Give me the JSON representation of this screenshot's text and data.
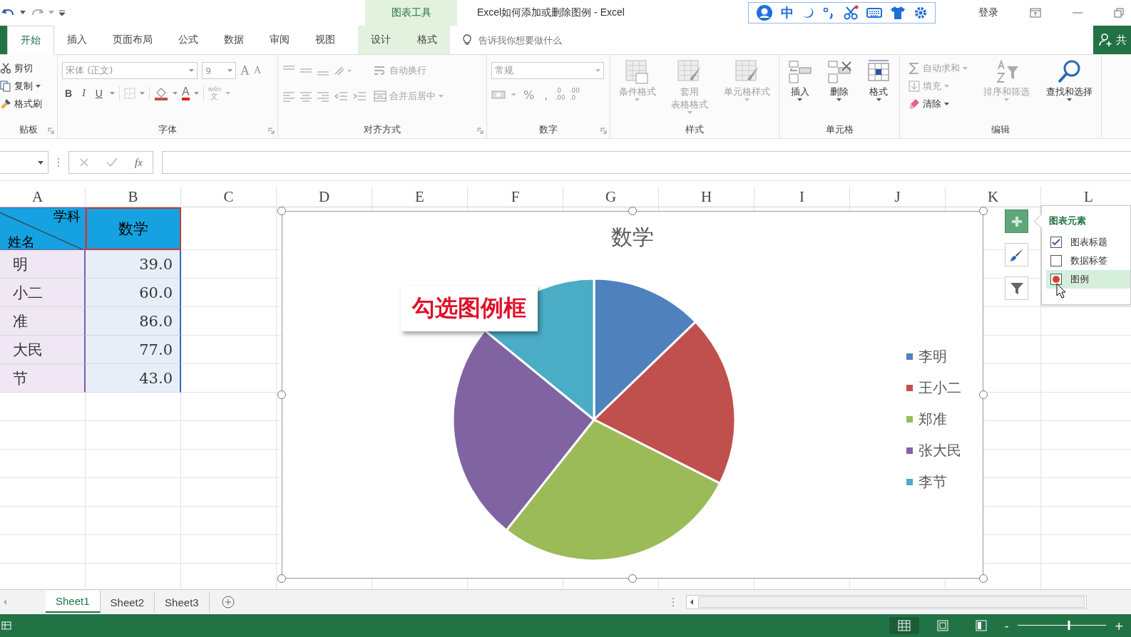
{
  "contextual_tab": "图表工具",
  "window": {
    "title": "Excel如何添加或删除图例  -  Excel",
    "ime_mode": "中",
    "sign_in": "登录"
  },
  "tabs": [
    {
      "label": "开始",
      "selected": true,
      "context": false
    },
    {
      "label": "插入",
      "selected": false,
      "context": false
    },
    {
      "label": "页面布局",
      "selected": false,
      "context": false
    },
    {
      "label": "公式",
      "selected": false,
      "context": false
    },
    {
      "label": "数据",
      "selected": false,
      "context": false
    },
    {
      "label": "审阅",
      "selected": false,
      "context": false
    },
    {
      "label": "视图",
      "selected": false,
      "context": false
    },
    {
      "label": "设计",
      "selected": false,
      "context": true
    },
    {
      "label": "格式",
      "selected": false,
      "context": true
    }
  ],
  "tell_me": {
    "placeholder": "告诉我你想要做什么"
  },
  "share": {
    "label": "共"
  },
  "ribbon": {
    "groups": [
      {
        "kind": "clipboard",
        "label": "贴板",
        "commands": [
          {
            "label": "剪切",
            "disabled": false
          },
          {
            "label": "复制",
            "disabled": false
          },
          {
            "label": "格式刷",
            "disabled": false
          }
        ]
      },
      {
        "kind": "font",
        "label": "字体",
        "disabled": true,
        "font_name": "宋体 (正文)",
        "font_size": "9",
        "grow_shrink": [
          "A",
          "A"
        ],
        "styles": [
          "B",
          "I",
          "U"
        ],
        "font_color": "A",
        "phonetic": [
          "wén",
          "文"
        ]
      },
      {
        "kind": "alignment",
        "label": "对齐方式",
        "disabled": true,
        "commands": [
          {
            "label": "自动换行"
          },
          {
            "label": "合并后居中"
          }
        ]
      },
      {
        "kind": "number",
        "label": "数字",
        "disabled": true,
        "format": "常规",
        "symbols": [
          "%",
          ","
        ],
        "decimals": [
          {
            "top": ".0",
            "bottom": ".00"
          },
          {
            "top": ".00",
            "bottom": ".0"
          }
        ]
      },
      {
        "kind": "styles",
        "label": "样式",
        "commands": [
          {
            "label": "条件格式",
            "disabled": true
          },
          {
            "label": "套用",
            "label_2": "表格格式",
            "disabled": true
          },
          {
            "label": "单元格样式",
            "disabled": true
          }
        ]
      },
      {
        "kind": "cells",
        "label": "单元格",
        "commands": [
          {
            "label": "插入",
            "disabled": false
          },
          {
            "label": "删除",
            "disabled": false
          },
          {
            "label": "格式",
            "disabled": false
          }
        ]
      },
      {
        "kind": "editing",
        "label": "编辑",
        "commands": [
          {
            "label": "自动求和",
            "disabled": true,
            "kind": "small"
          },
          {
            "label": "填充",
            "disabled": true,
            "kind": "small"
          },
          {
            "label": "清除",
            "disabled": false,
            "kind": "small"
          },
          {
            "label": "排序和筛选",
            "disabled": true,
            "kind": "large"
          },
          {
            "label": "查找和选择",
            "disabled": false,
            "kind": "large"
          }
        ]
      }
    ]
  },
  "formula_bar": {
    "function_label": "fx"
  },
  "sheet": {
    "columns": [
      "A",
      "B",
      "C",
      "D",
      "E",
      "F",
      "G",
      "H",
      "I",
      "J",
      "K",
      "L"
    ],
    "table": {
      "header_top": "学科",
      "header_bottom": "姓名",
      "subject": "数学",
      "rows": [
        {
          "name": "明",
          "score": "39.0"
        },
        {
          "name": "小二",
          "score": "60.0"
        },
        {
          "name": "准",
          "score": "86.0"
        },
        {
          "name": "大民",
          "score": "77.0"
        },
        {
          "name": "节",
          "score": "43.0"
        }
      ]
    }
  },
  "chart": {
    "selected": true,
    "callout": "勾选图例框",
    "chart_data": {
      "type": "pie",
      "title": "数学",
      "categories": [
        "李明",
        "王小二",
        "郑准",
        "张大民",
        "李节"
      ],
      "values": [
        12.79,
        19.67,
        28.2,
        25.25,
        14.09
      ],
      "legend": "right",
      "colors": [
        "#4f81bd",
        "#c0504d",
        "#9bbb59",
        "#8064a2",
        "#4bacc6"
      ]
    },
    "tools": [
      {
        "kind": "elements",
        "selected": true
      },
      {
        "kind": "styles",
        "selected": false
      },
      {
        "kind": "filters",
        "selected": false
      }
    ],
    "elements_panel": {
      "title": "图表元素",
      "items": [
        {
          "label": "图表标题",
          "checked": true,
          "hovered": false
        },
        {
          "label": "数据标签",
          "checked": false,
          "hovered": false
        },
        {
          "label": "图例",
          "checked": false,
          "hovered": true
        }
      ]
    }
  },
  "sheet_tabs": [
    {
      "label": "Sheet1",
      "selected": true
    },
    {
      "label": "Sheet2",
      "selected": false
    },
    {
      "label": "Sheet3",
      "selected": false
    }
  ],
  "status_bar": {
    "views": [
      {
        "kind": "normal",
        "selected": true
      },
      {
        "kind": "page_layout",
        "selected": false
      },
      {
        "kind": "page_break",
        "selected": false
      }
    ],
    "zoom": {
      "level": 0.58
    },
    "zoom_in": "+",
    "zoom_out": "-"
  }
}
